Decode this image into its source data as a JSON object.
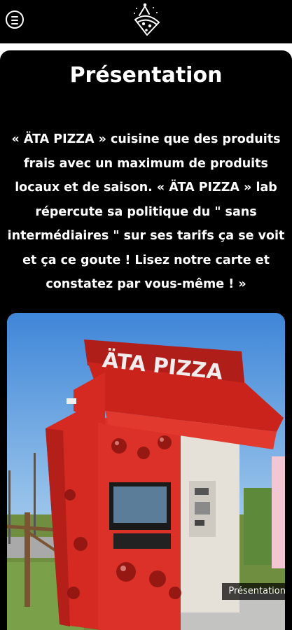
{
  "header": {
    "menu_icon": "hamburger-menu-icon",
    "logo_icon": "pizza-slice-party-hat-icon"
  },
  "section": {
    "title": "Présentation",
    "description": "« ÄTA PIZZA »  cuisine que des produits frais avec un maximum de produits locaux et de saison. « ÄTA PIZZA » lab répercute sa politique du \" sans intermédiaires \" sur ses tarifs ça se voit  et ça ce goute ! Lisez notre carte et constatez par vous-même ! »"
  },
  "photo": {
    "sign_text": "ÄTA PIZZA",
    "caption": "Présentation"
  },
  "colors": {
    "background": "#000000",
    "text": "#ffffff",
    "kiosk_red": "#d42a22"
  }
}
